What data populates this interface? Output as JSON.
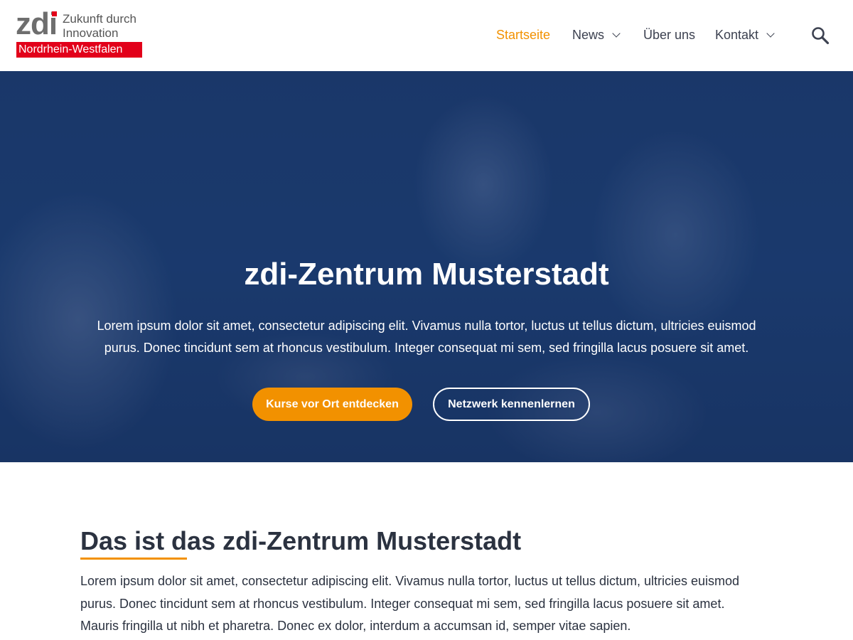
{
  "header": {
    "logo": {
      "mark": "zdi",
      "tagline_line1": "Zukunft durch",
      "tagline_line2": "Innovation",
      "region": "Nordrhein-Westfalen"
    },
    "nav": [
      {
        "label": "Startseite",
        "active": true,
        "has_dropdown": false
      },
      {
        "label": "News",
        "active": false,
        "has_dropdown": true
      },
      {
        "label": "Über uns",
        "active": false,
        "has_dropdown": false
      },
      {
        "label": "Kontakt",
        "active": false,
        "has_dropdown": true
      }
    ],
    "search_icon": "search-icon"
  },
  "hero": {
    "title": "zdi-Zentrum Musterstadt",
    "text": "Lorem ipsum dolor sit amet, consectetur adipiscing elit. Vivamus nulla tortor, luctus ut tellus dictum, ultricies euismod purus. Donec tincidunt sem at rhoncus vestibulum. Integer consequat mi sem, sed fringilla lacus posuere sit amet.",
    "primary_button": "Kurse vor Ort entdecken",
    "secondary_button": "Netzwerk kennenlernen"
  },
  "about": {
    "title": "Das ist das zdi-Zentrum Musterstadt",
    "text": "Lorem ipsum dolor sit amet, consectetur adipiscing elit. Vivamus nulla tortor, luctus ut tellus dictum, ultricies euismod purus. Donec tincidunt sem at rhoncus vestibulum. Integer consequat mi sem, sed fringilla lacus posuere sit amet. Mauris fringilla ut nibh et pharetra. Donec ex dolor, interdum a accumsan id, semper vitae sapien."
  },
  "colors": {
    "accent": "#f29100",
    "brand_red": "#e2001a",
    "hero_blue": "#1c3d70",
    "text_dark": "#2b3240"
  }
}
